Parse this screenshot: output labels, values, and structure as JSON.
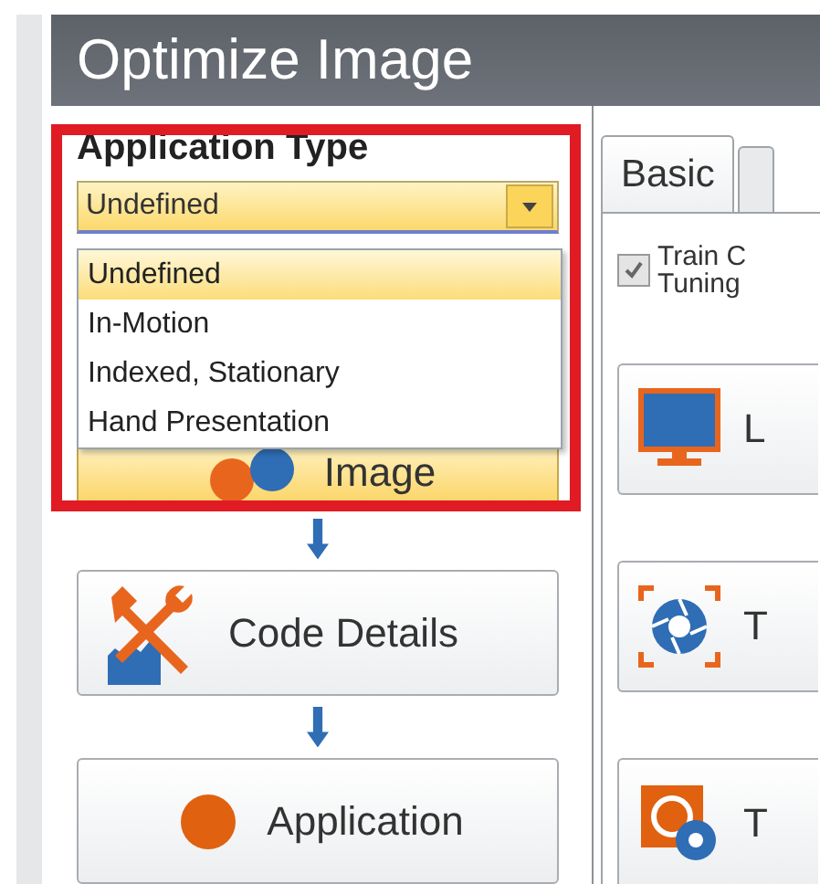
{
  "title": "Optimize Image",
  "application_type": {
    "label": "Application Type",
    "value": "Undefined",
    "expanded": true,
    "highlighted": true,
    "options": [
      {
        "label": "Undefined",
        "selected": true
      },
      {
        "label": "In-Motion",
        "selected": false
      },
      {
        "label": "Indexed, Stationary",
        "selected": false
      },
      {
        "label": "Hand Presentation",
        "selected": false
      }
    ]
  },
  "steps": [
    {
      "label": "Image",
      "selected": true
    },
    {
      "label": "Code Details",
      "selected": false
    },
    {
      "label": "Application",
      "selected": false
    }
  ],
  "tabs": [
    {
      "label": "Basic",
      "selected": true
    },
    {
      "selected": false
    }
  ],
  "train_checkbox": {
    "lines": [
      "Train C",
      "Tuning"
    ],
    "checked": true
  },
  "actions": [
    {
      "label": "L"
    },
    {
      "label": "T"
    },
    {
      "label": "T"
    }
  ]
}
